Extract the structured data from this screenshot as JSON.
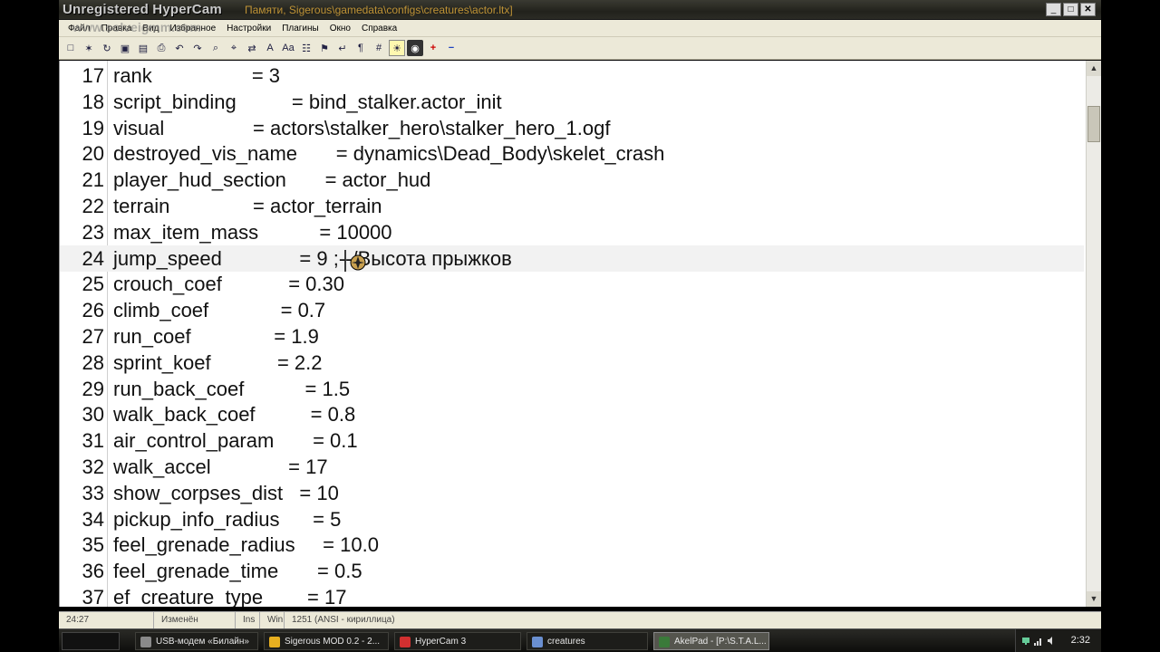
{
  "window": {
    "watermark": "Unregistered HyperCam",
    "watermark_url": "www.solveigmm.com",
    "title_path": "Памяти, Sigerous\\gamedata\\configs\\creatures\\actor.ltx]",
    "minimize": "_",
    "maximize": "□",
    "close": "✕"
  },
  "menu": [
    {
      "label": "Файл"
    },
    {
      "label": "Правка"
    },
    {
      "label": "Вид"
    },
    {
      "label": "Избранное"
    },
    {
      "label": "Настройки"
    },
    {
      "label": "Плагины"
    },
    {
      "label": "Окно"
    },
    {
      "label": "Справка"
    }
  ],
  "toolbar": [
    {
      "icon": "new-file-icon",
      "glyph": "□"
    },
    {
      "icon": "open-icon",
      "glyph": "✶"
    },
    {
      "icon": "reopen-icon",
      "glyph": "↻"
    },
    {
      "icon": "save-icon",
      "glyph": "▣"
    },
    {
      "icon": "save-all-icon",
      "glyph": "▤"
    },
    {
      "icon": "print-icon",
      "glyph": "⎙"
    },
    {
      "icon": "undo-icon",
      "glyph": "↶"
    },
    {
      "icon": "redo-icon",
      "glyph": "↷"
    },
    {
      "icon": "find-icon",
      "glyph": "⌕"
    },
    {
      "icon": "find-next-icon",
      "glyph": "⌖"
    },
    {
      "icon": "replace-icon",
      "glyph": "⇄"
    },
    {
      "icon": "font-icon",
      "glyph": "A"
    },
    {
      "icon": "case-icon",
      "glyph": "Aa"
    },
    {
      "icon": "codepage-icon",
      "glyph": "☷"
    },
    {
      "icon": "flag-icon",
      "glyph": "⚑"
    },
    {
      "icon": "wordwrap-icon",
      "glyph": "↵"
    },
    {
      "icon": "show-spaces-icon",
      "glyph": "¶"
    },
    {
      "icon": "hex-icon",
      "glyph": "#"
    },
    {
      "icon": "lightbulb-icon",
      "glyph": "☀"
    },
    {
      "icon": "recording-icon",
      "glyph": "◉"
    },
    {
      "icon": "zoom-in-icon",
      "glyph": "+"
    },
    {
      "icon": "zoom-out-icon",
      "glyph": "−"
    }
  ],
  "editor": {
    "lines": [
      {
        "n": "17",
        "text": "rank                  = 3"
      },
      {
        "n": "18",
        "text": "script_binding          = bind_stalker.actor_init"
      },
      {
        "n": "19",
        "text": "visual                = actors\\stalker_hero\\stalker_hero_1.ogf"
      },
      {
        "n": "20",
        "text": "destroyed_vis_name       = dynamics\\Dead_Body\\skelet_crash"
      },
      {
        "n": "21",
        "text": "player_hud_section       = actor_hud"
      },
      {
        "n": "22",
        "text": "terrain               = actor_terrain"
      },
      {
        "n": "23",
        "text": "max_item_mass           = 10000"
      },
      {
        "n": "24",
        "text": "jump_speed              = 9 ;--/Высота прыжков"
      },
      {
        "n": "25",
        "text": "crouch_coef            = 0.30"
      },
      {
        "n": "26",
        "text": "climb_coef             = 0.7"
      },
      {
        "n": "27",
        "text": "run_coef               = 1.9"
      },
      {
        "n": "28",
        "text": "sprint_koef            = 2.2"
      },
      {
        "n": "29",
        "text": "run_back_coef           = 1.5"
      },
      {
        "n": "30",
        "text": "walk_back_coef          = 0.8"
      },
      {
        "n": "31",
        "text": "air_control_param       = 0.1"
      },
      {
        "n": "32",
        "text": "walk_accel              = 17"
      },
      {
        "n": "33",
        "text": "show_corpses_dist   = 10"
      },
      {
        "n": "34",
        "text": "pickup_info_radius      = 5"
      },
      {
        "n": "35",
        "text": "feel_grenade_radius     = 10.0"
      },
      {
        "n": "36",
        "text": "feel_grenade_time       = 0.5"
      },
      {
        "n": "37",
        "text": "ef_creature_type        = 17"
      }
    ],
    "current_line": "24"
  },
  "status": {
    "position": "24:27",
    "modified": "Изменён",
    "insert_mode": "Ins",
    "newline": "Win",
    "encoding": "1251  (ANSI - кириллица)"
  },
  "taskbar": {
    "tasks": [
      {
        "label": "USB-модем «Билайн»",
        "icon": "usb-modem-icon",
        "color": "#8a8a8a"
      },
      {
        "label": "Sigerous MOD 0.2 - 2...",
        "icon": "chrome-icon",
        "color": "#e8b020"
      },
      {
        "label": "HyperCam 3",
        "icon": "hypercam-icon",
        "color": "#d23030"
      },
      {
        "label": "creatures",
        "icon": "folder-icon",
        "color": "#6a8fd0"
      },
      {
        "label": "AkelPad - [P:\\S.T.A.L...",
        "icon": "akelpad-icon",
        "color": "#3a7a3a"
      }
    ],
    "active_task": "AkelPad - [P:\\S.T.A.L...",
    "clock": "2:32"
  }
}
